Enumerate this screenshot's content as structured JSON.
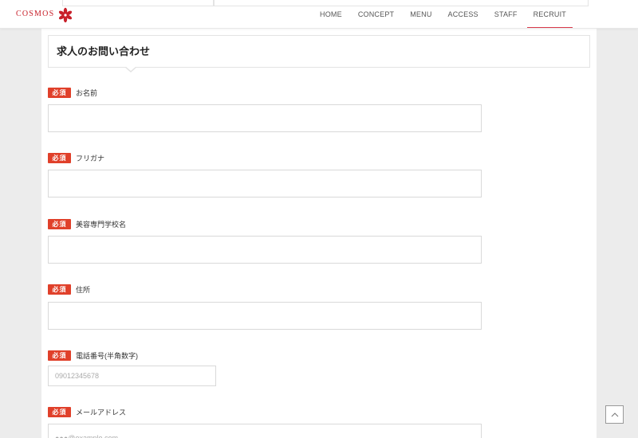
{
  "brand": {
    "name": "COSMOS",
    "accent": "#c8202a"
  },
  "nav": {
    "items": [
      {
        "label": "HOME"
      },
      {
        "label": "CONCEPT"
      },
      {
        "label": "MENU"
      },
      {
        "label": "ACCESS"
      },
      {
        "label": "STAFF"
      },
      {
        "label": "RECRUIT",
        "active": true
      }
    ]
  },
  "form": {
    "title": "求人のお問い合わせ",
    "required_label": "必須",
    "fields": [
      {
        "label": "お名前",
        "placeholder": "",
        "value": ""
      },
      {
        "label": "フリガナ",
        "placeholder": "",
        "value": ""
      },
      {
        "label": "美容専門学校名",
        "placeholder": "",
        "value": ""
      },
      {
        "label": "住所",
        "placeholder": "",
        "value": ""
      },
      {
        "label": "電話番号(半角数字)",
        "placeholder": "09012345678",
        "value": ""
      },
      {
        "label": "メールアドレス",
        "placeholder": "●●●@example.com",
        "value": ""
      }
    ]
  },
  "scroll_top": {
    "icon": "chevron-up-icon"
  },
  "colors": {
    "required_badge": "#e0402a",
    "nav_active_underline": "#d9394a"
  }
}
